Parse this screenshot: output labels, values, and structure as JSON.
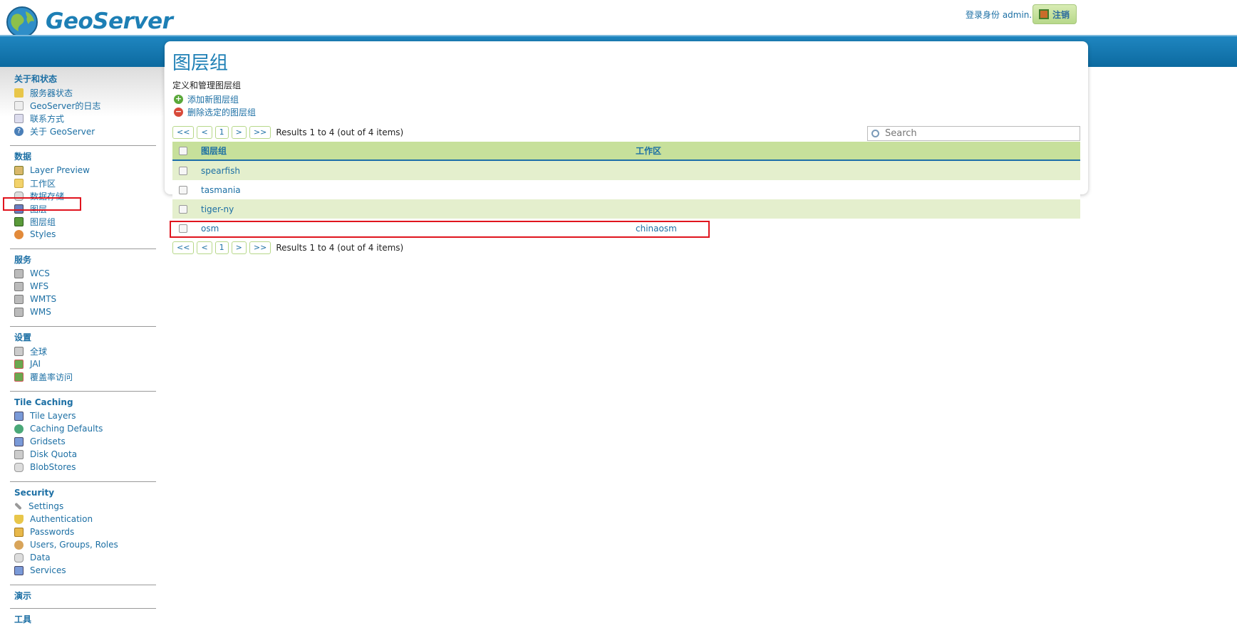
{
  "header": {
    "brand": "GeoServer",
    "user_info": "登录身份 admin.",
    "logout_label": "注销"
  },
  "sidebar": {
    "sections": [
      {
        "title": "关于和状态",
        "items": [
          "服务器状态",
          "GeoServer的日志",
          "联系方式",
          "关于 GeoServer"
        ]
      },
      {
        "title": "数据",
        "items": [
          "Layer Preview",
          "工作区",
          "数据存储",
          "图层",
          "图层组",
          "Styles"
        ]
      },
      {
        "title": "服务",
        "items": [
          "WCS",
          "WFS",
          "WMTS",
          "WMS"
        ]
      },
      {
        "title": "设置",
        "items": [
          "全球",
          "JAI",
          "覆盖率访问"
        ]
      },
      {
        "title": "Tile Caching",
        "items": [
          "Tile Layers",
          "Caching Defaults",
          "Gridsets",
          "Disk Quota",
          "BlobStores"
        ]
      },
      {
        "title": "Security",
        "items": [
          "Settings",
          "Authentication",
          "Passwords",
          "Users, Groups, Roles",
          "Data",
          "Services"
        ]
      },
      {
        "title": "演示",
        "items": []
      },
      {
        "title": "工具",
        "items": []
      }
    ]
  },
  "main": {
    "title": "图层组",
    "description": "定义和管理图层组",
    "add_label": "添加新图层组",
    "remove_label": "删除选定的图层组",
    "search_placeholder": "Search",
    "pager": {
      "first": "<<",
      "prev": "<",
      "page": "1",
      "next": ">",
      "last": ">>",
      "info": "Results 1 to 4 (out of 4 items)"
    },
    "table": {
      "columns": [
        "图层组",
        "工作区"
      ],
      "rows": [
        [
          "spearfish",
          ""
        ],
        [
          "tasmania",
          ""
        ],
        [
          "tiger-ny",
          ""
        ],
        [
          "osm",
          "chinaosm"
        ]
      ]
    }
  },
  "colors": {
    "link": "#1c6fa4",
    "header_row": "#c7e09b",
    "odd_row": "#e4efcd",
    "blue_bar": "#0c6aa0",
    "highlight": "#e0141e"
  }
}
